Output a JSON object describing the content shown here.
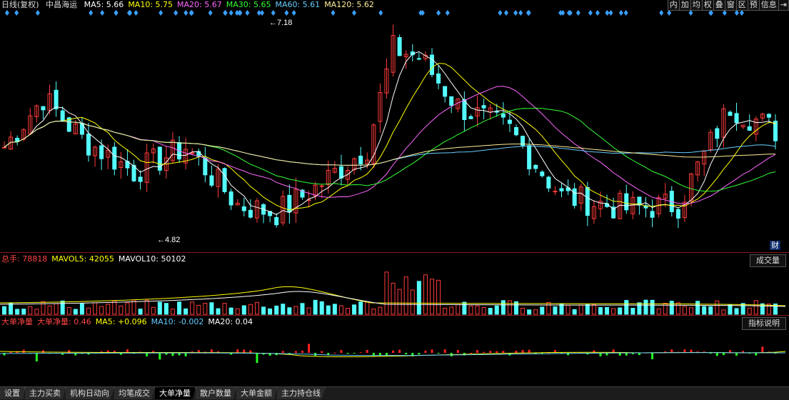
{
  "title": "日线(复权)",
  "stock_name": "中昌海运",
  "ma_legend": [
    {
      "label": "MA5: 5.66",
      "color": "#ffffff"
    },
    {
      "label": "MA10: 5.75",
      "color": "#ffff00"
    },
    {
      "label": "MA20: 5.67",
      "color": "#ff66ff"
    },
    {
      "label": "MA30: 5.65",
      "color": "#33ff33"
    },
    {
      "label": "MA60: 5.61",
      "color": "#66ccff"
    },
    {
      "label": "MA120: 5.62",
      "color": "#ffee99"
    }
  ],
  "toolbar": [
    "内",
    "加",
    "均",
    "权",
    "叠",
    "窗",
    "区",
    "预",
    "信息",
    "⇥"
  ],
  "high_label": "7.18",
  "low_label": "4.82",
  "fin_badge": "财",
  "volume": {
    "legend": [
      {
        "label": "总手: 78818",
        "color": "#ff4444"
      },
      {
        "label": "MAVOL5: 42055",
        "color": "#ffff00"
      },
      {
        "label": "MAVOL10: 50102",
        "color": "#ffffff"
      }
    ],
    "button": "成交量"
  },
  "bigorder": {
    "legend": [
      {
        "label": "大单净量",
        "color": "#ff4444"
      },
      {
        "label": "大单净量: 0.46",
        "color": "#ff4444"
      },
      {
        "label": "MA5: +0.096",
        "color": "#ffff00"
      },
      {
        "label": "MA10: -0.002",
        "color": "#66ccff"
      },
      {
        "label": "MA20: 0.04",
        "color": "#ffffff"
      }
    ],
    "button": "指标说明"
  },
  "tabs": [
    {
      "label": "设置",
      "active": false
    },
    {
      "label": "主力买卖",
      "active": false
    },
    {
      "label": "机构日动向",
      "active": false
    },
    {
      "label": "均笔成交",
      "active": false
    },
    {
      "label": "大单净量",
      "active": true
    },
    {
      "label": "散户数量",
      "active": false
    },
    {
      "label": "大单金额",
      "active": false
    },
    {
      "label": "主力持仓线",
      "active": false
    }
  ],
  "colors": {
    "up": "#ff3b3b",
    "down": "#54ffff",
    "grid": "#8b1a1a"
  }
}
